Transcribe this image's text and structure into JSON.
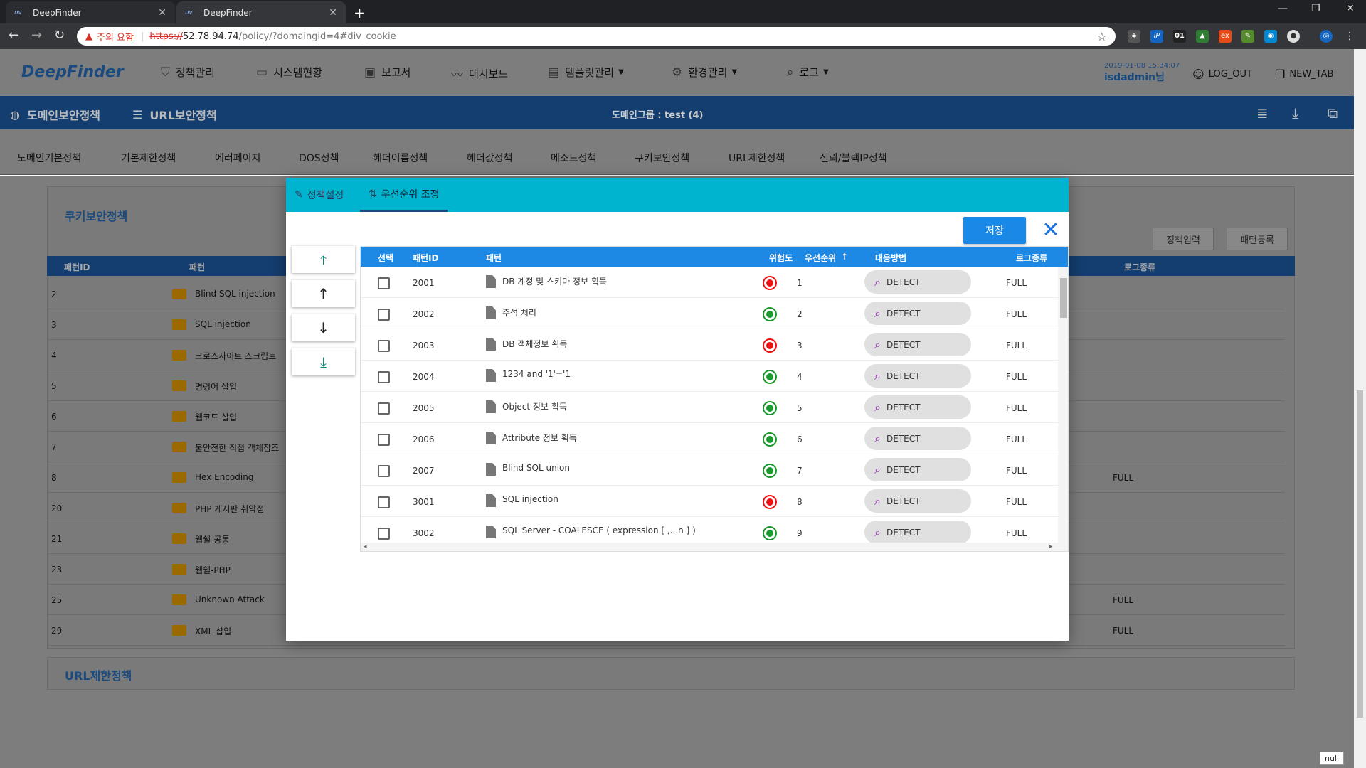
{
  "browser": {
    "tabs": [
      {
        "title": "DeepFinder",
        "icon": "deepfinder-favicon"
      },
      {
        "title": "DeepFinder",
        "icon": "deepfinder-favicon"
      }
    ],
    "security_warning": "주의 요함",
    "url_scheme": "https://",
    "url_host": "52.78.94.74",
    "url_path": "/policy/?domaingid=4#div_cookie",
    "extension_label": "01"
  },
  "header": {
    "logo": "DeepFinder",
    "nav": [
      {
        "label": "정책관리",
        "icon": "shield-icon"
      },
      {
        "label": "시스템현황",
        "icon": "monitor-icon"
      },
      {
        "label": "보고서",
        "icon": "clipboard-icon"
      },
      {
        "label": "대시보드",
        "icon": "trend-icon"
      },
      {
        "label": "템플릿관리",
        "icon": "template-icon",
        "dropdown": true
      },
      {
        "label": "환경관리",
        "icon": "gear-icon",
        "dropdown": true
      },
      {
        "label": "로그",
        "icon": "search-icon",
        "dropdown": true
      }
    ],
    "timestamp": "2019-01-08 15:34:07",
    "user": "isdadmin님",
    "logout": "LOG_OUT",
    "newtab": "NEW_TAB"
  },
  "subbar": {
    "domain_policy": "도메인보안정책",
    "url_policy": "URL보안정책",
    "domain_group": "도메인그룹 : test (4)"
  },
  "policy_tabs": [
    "도메인기본정책",
    "기본제한정책",
    "에러페이지",
    "DOS정책",
    "헤더이름정책",
    "헤더값정책",
    "메소드정책",
    "쿠키보안정책",
    "URL제한정책",
    "신뢰/블랙IP정책"
  ],
  "background": {
    "cookie_card_title": "쿠키보안정책",
    "url_card_title": "URL제한정책",
    "btn_policy_input": "정책입력",
    "btn_pattern_register": "패턴등록",
    "columns": {
      "id": "패턴ID",
      "pattern": "패턴",
      "log": "로그종류"
    },
    "rows": [
      {
        "id": "2",
        "name": "Blind SQL injection",
        "log": ""
      },
      {
        "id": "3",
        "name": "SQL injection",
        "log": ""
      },
      {
        "id": "4",
        "name": "크로스사이트 스크립트",
        "log": ""
      },
      {
        "id": "5",
        "name": "명령어 삽입",
        "log": ""
      },
      {
        "id": "6",
        "name": "웹코드 삽입",
        "log": ""
      },
      {
        "id": "7",
        "name": "불안전한 직접 객체참조",
        "log": ""
      },
      {
        "id": "8",
        "name": "Hex Encoding",
        "log": "FULL"
      },
      {
        "id": "20",
        "name": "PHP 게시판 취약점",
        "log": ""
      },
      {
        "id": "21",
        "name": "웹쉘-공통",
        "log": ""
      },
      {
        "id": "23",
        "name": "웹쉘-PHP",
        "log": ""
      },
      {
        "id": "25",
        "name": "Unknown Attack",
        "log": "FULL"
      },
      {
        "id": "29",
        "name": "XML 삽입",
        "log": "FULL"
      }
    ],
    "null_label": "null"
  },
  "modal": {
    "tab_settings": "정책설정",
    "tab_priority": "우선순위 조정",
    "save": "저장",
    "columns": {
      "select": "선택",
      "id": "패턴ID",
      "pattern": "패턴",
      "risk": "위험도",
      "priority": "우선순위",
      "action": "대응방법",
      "log": "로그종류"
    },
    "rows": [
      {
        "id": "2001",
        "name": "DB 계정 및 스키마 정보 획득",
        "risk": "high",
        "priority": "1",
        "action": "DETECT",
        "log": "FULL"
      },
      {
        "id": "2002",
        "name": "주석 처리",
        "risk": "low",
        "priority": "2",
        "action": "DETECT",
        "log": "FULL"
      },
      {
        "id": "2003",
        "name": "DB 객체정보 획득",
        "risk": "high",
        "priority": "3",
        "action": "DETECT",
        "log": "FULL"
      },
      {
        "id": "2004",
        "name": "1234 and '1'='1",
        "risk": "low",
        "priority": "4",
        "action": "DETECT",
        "log": "FULL"
      },
      {
        "id": "2005",
        "name": "Object 정보 획득",
        "risk": "low",
        "priority": "5",
        "action": "DETECT",
        "log": "FULL"
      },
      {
        "id": "2006",
        "name": "Attribute 정보 획득",
        "risk": "low",
        "priority": "6",
        "action": "DETECT",
        "log": "FULL"
      },
      {
        "id": "2007",
        "name": "Blind SQL union",
        "risk": "low",
        "priority": "7",
        "action": "DETECT",
        "log": "FULL"
      },
      {
        "id": "3001",
        "name": "SQL injection",
        "risk": "high",
        "priority": "8",
        "action": "DETECT",
        "log": "FULL"
      },
      {
        "id": "3002",
        "name": "SQL Server - COALESCE ( expression [ ,...n ] )",
        "risk": "low",
        "priority": "9",
        "action": "DETECT",
        "log": "FULL"
      }
    ]
  }
}
